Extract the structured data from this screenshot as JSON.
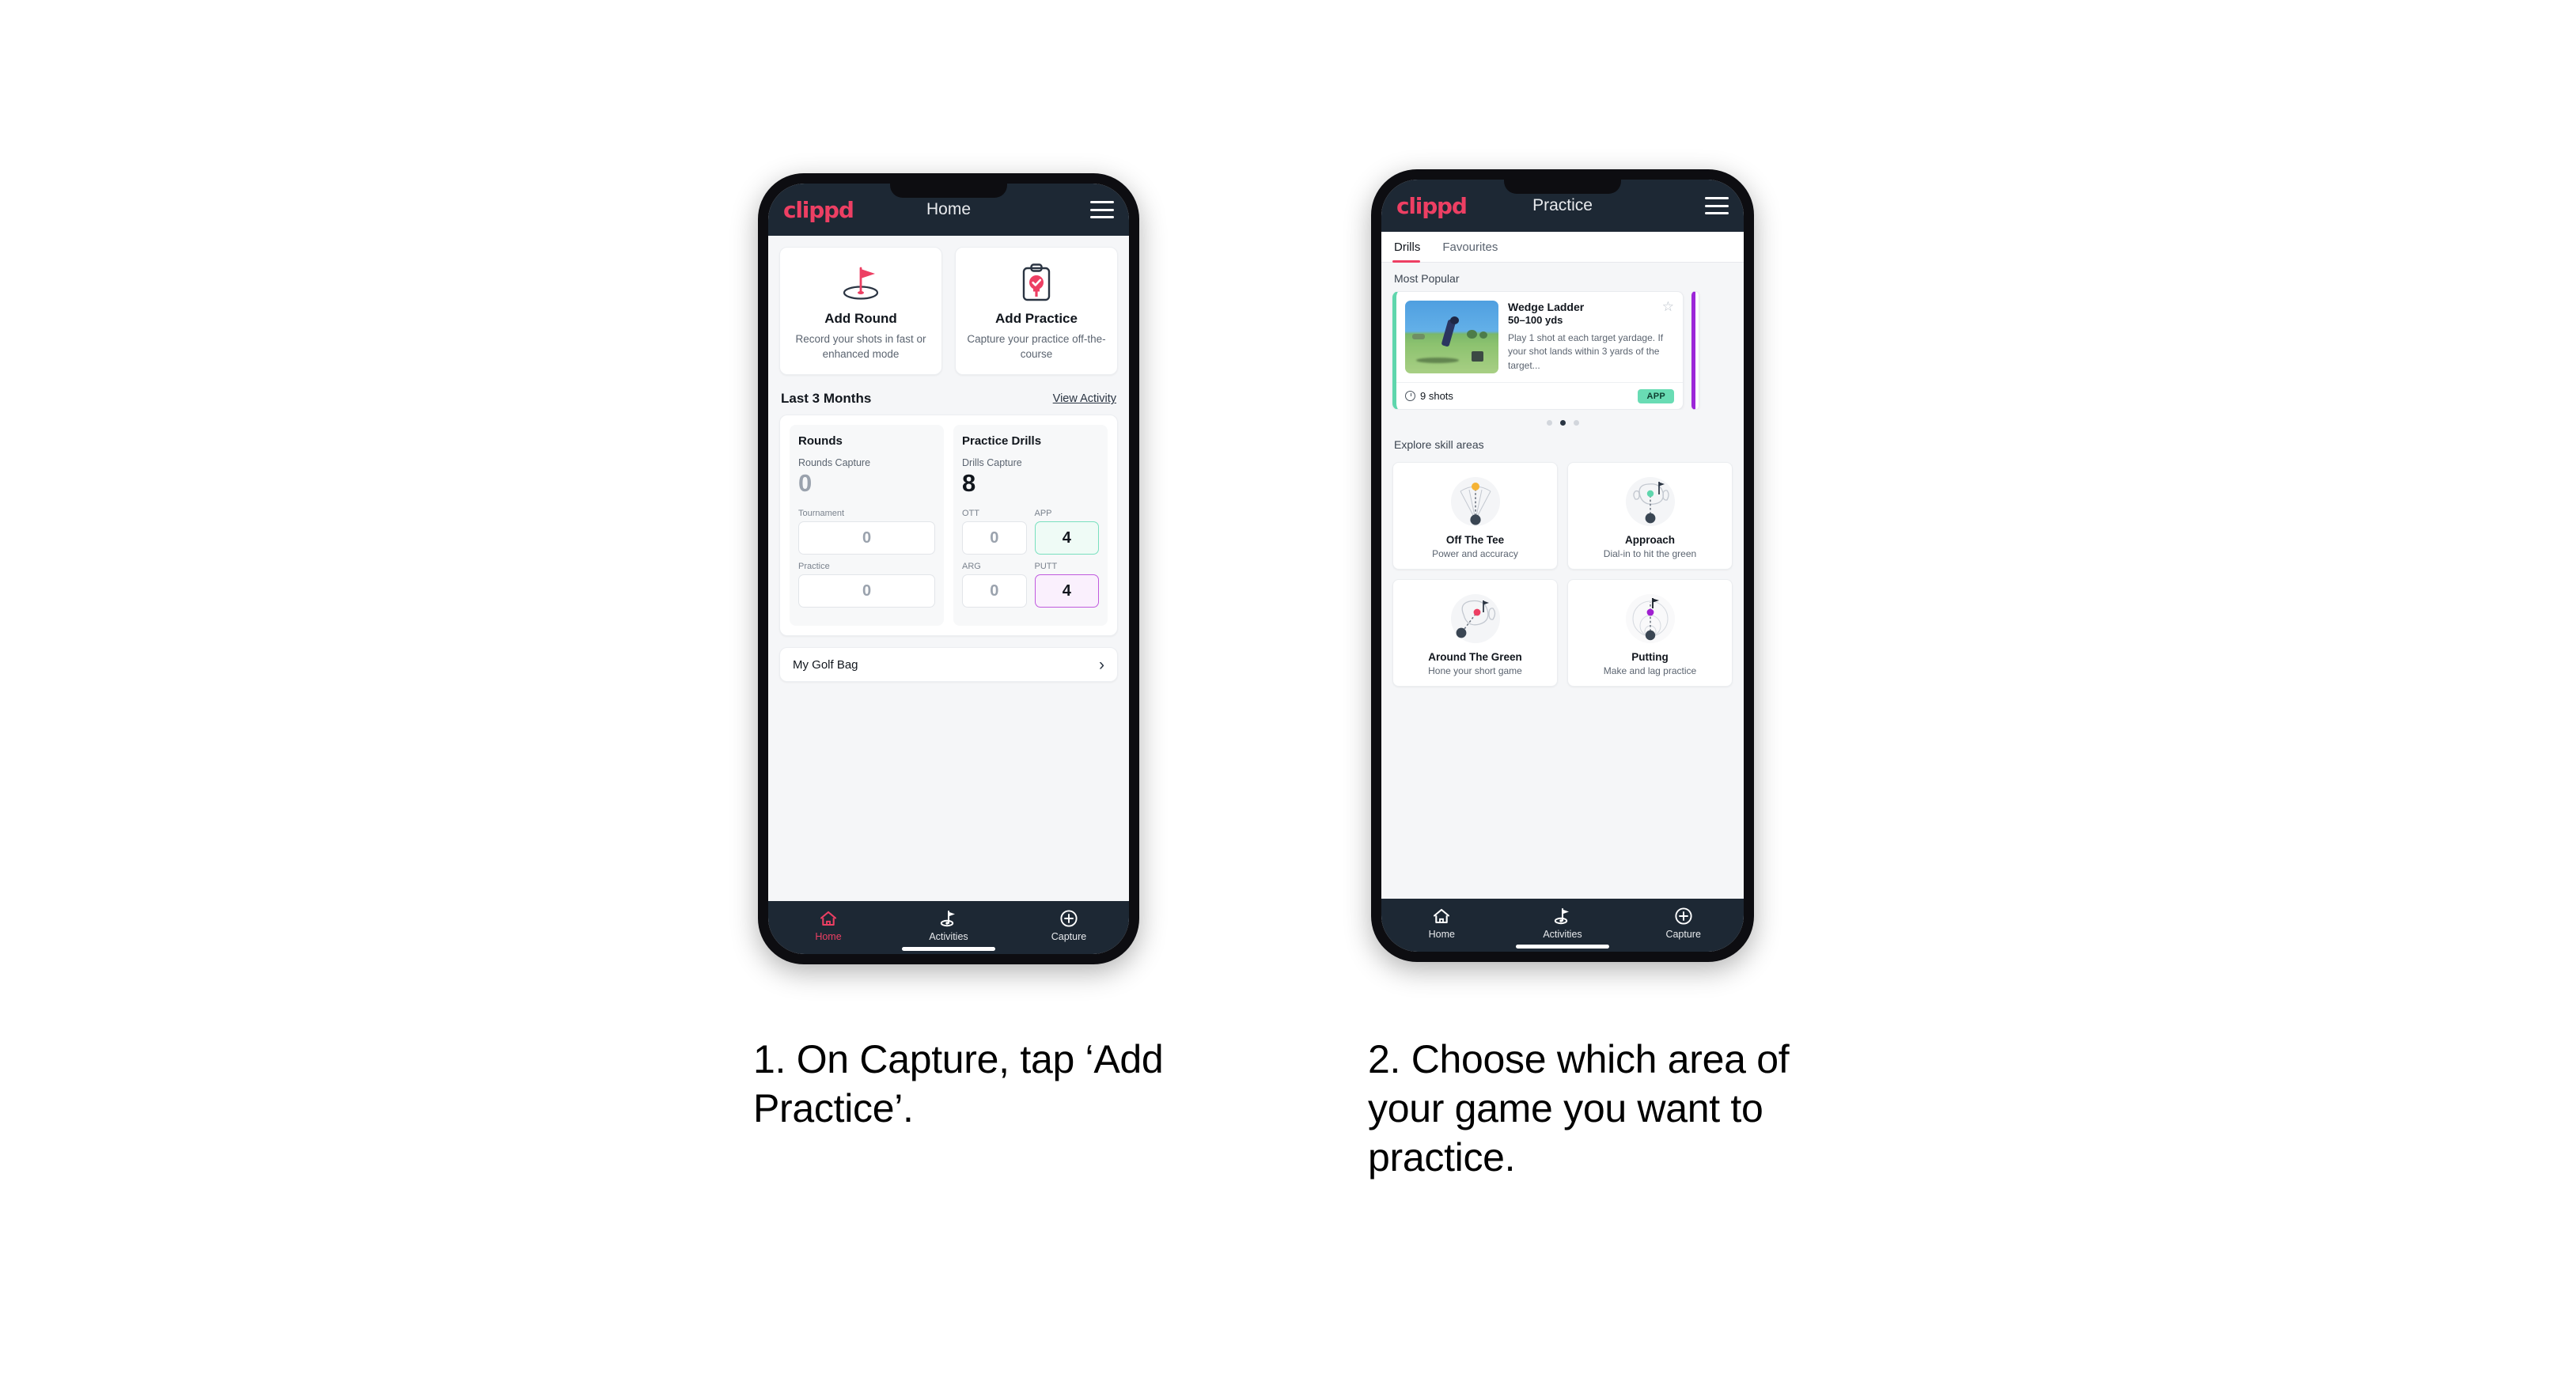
{
  "page": {
    "background": "#ffffff",
    "accent_pink": "#ed3f63",
    "header_dark": "#1d2834",
    "app_green": "#69dcb4",
    "app_purple": "#c05ade"
  },
  "phone1": {
    "header": {
      "brand": "clippd",
      "title": "Home",
      "menu_icon": "hamburger-icon"
    },
    "quick_actions": [
      {
        "icon": "golf-flag-hole-icon",
        "title": "Add Round",
        "subtitle": "Record your shots in fast or enhanced mode"
      },
      {
        "icon": "clipboard-check-tee-icon",
        "title": "Add Practice",
        "subtitle": "Capture your practice off-the-course"
      }
    ],
    "section": {
      "title": "Last 3 Months",
      "link": "View Activity"
    },
    "stats": {
      "rounds": {
        "title": "Rounds",
        "capture_label": "Rounds Capture",
        "capture_value": "0",
        "items": [
          {
            "label": "Tournament",
            "value": "0",
            "style": "plain"
          },
          {
            "label": "Practice",
            "value": "0",
            "style": "plain"
          }
        ]
      },
      "drills": {
        "title": "Practice Drills",
        "capture_label": "Drills Capture",
        "capture_value": "8",
        "items": [
          {
            "label": "OTT",
            "value": "0",
            "style": "plain"
          },
          {
            "label": "APP",
            "value": "4",
            "style": "app"
          },
          {
            "label": "ARG",
            "value": "0",
            "style": "plain"
          },
          {
            "label": "PUTT",
            "value": "4",
            "style": "putt"
          }
        ]
      }
    },
    "golf_bag": {
      "label": "My Golf Bag",
      "chevron": "chevron-right-icon"
    },
    "bottom_nav": {
      "items": [
        {
          "icon": "home-icon",
          "label": "Home",
          "active": true
        },
        {
          "icon": "golf-flag-icon",
          "label": "Activities",
          "active": false
        },
        {
          "icon": "plus-circle-icon",
          "label": "Capture",
          "active": false
        }
      ]
    }
  },
  "phone2": {
    "header": {
      "brand": "clippd",
      "title": "Practice",
      "menu_icon": "hamburger-icon"
    },
    "tabs": [
      {
        "label": "Drills",
        "active": true
      },
      {
        "label": "Favourites",
        "active": false
      }
    ],
    "most_popular_label": "Most Popular",
    "drill_card": {
      "name": "Wedge Ladder",
      "range": "50–100 yds",
      "description": "Play 1 shot at each target yardage. If your shot lands within 3 yards of the target...",
      "shots": "9 shots",
      "badge": "APP",
      "badge_color": "#69dcb4",
      "accent_color": "#5fd6ad",
      "star_icon": "star-outline-icon",
      "clock_icon": "clock-icon",
      "thumbnail": "golfer-wedge-shot-photo"
    },
    "next_card_accent": "#9c27d8",
    "carousel_dots": {
      "count": 3,
      "active_index": 1
    },
    "explore_label": "Explore skill areas",
    "skill_areas": [
      {
        "icon": "off-the-tee-fan-icon",
        "name": "Off The Tee",
        "subtitle": "Power and accuracy",
        "dot_color": "#f5b335"
      },
      {
        "icon": "approach-green-icon",
        "name": "Approach",
        "subtitle": "Dial-in to hit the green",
        "dot_color": "#5fd6ad"
      },
      {
        "icon": "around-the-green-icon",
        "name": "Around The Green",
        "subtitle": "Hone your short game",
        "dot_color": "#ed3f63"
      },
      {
        "icon": "putting-rings-icon",
        "name": "Putting",
        "subtitle": "Make and lag practice",
        "dot_color": "#a020d0"
      }
    ],
    "bottom_nav": {
      "items": [
        {
          "icon": "home-icon",
          "label": "Home",
          "active": false
        },
        {
          "icon": "golf-flag-icon",
          "label": "Activities",
          "active": false
        },
        {
          "icon": "plus-circle-icon",
          "label": "Capture",
          "active": false
        }
      ]
    }
  },
  "captions": {
    "step1": "1. On Capture, tap ‘Add Practice’.",
    "step2": "2. Choose which area of your game you want to practice."
  }
}
